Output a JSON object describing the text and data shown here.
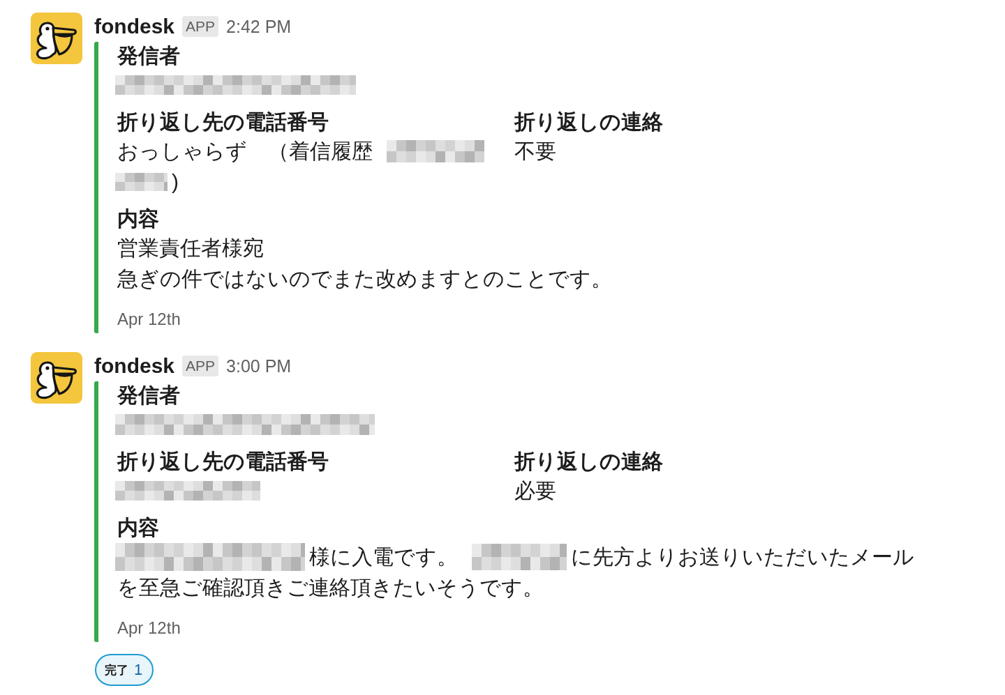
{
  "messages": [
    {
      "sender": "fondesk",
      "badge": "APP",
      "time": "2:42 PM",
      "attachment": {
        "rows": [
          [
            {
              "title": "発信者",
              "lines": [
                [
                  {
                    "kind": "redacted"
                  }
                ]
              ]
            }
          ],
          [
            {
              "title": "折り返し先の電話番号",
              "lines": [
                [
                  {
                    "kind": "text",
                    "text": "おっしゃらず　（着信履歴"
                  },
                  {
                    "kind": "redacted"
                  }
                ],
                [
                  {
                    "kind": "redacted"
                  },
                  {
                    "kind": "text",
                    "text": ")"
                  }
                ]
              ]
            },
            {
              "title": "折り返しの連絡",
              "lines": [
                [
                  {
                    "kind": "text",
                    "text": "不要"
                  }
                ]
              ]
            }
          ],
          [
            {
              "title": "内容",
              "lines": [
                [
                  {
                    "kind": "text",
                    "text": "営業責任者様宛"
                  }
                ],
                [
                  {
                    "kind": "text",
                    "text": "急ぎの件ではないのでまた改めますとのことです。"
                  }
                ]
              ]
            }
          ]
        ],
        "footer": "Apr 12th"
      }
    },
    {
      "sender": "fondesk",
      "badge": "APP",
      "time": "3:00 PM",
      "attachment": {
        "rows": [
          [
            {
              "title": "発信者",
              "lines": [
                [
                  {
                    "kind": "redacted"
                  }
                ]
              ]
            }
          ],
          [
            {
              "title": "折り返し先の電話番号",
              "lines": [
                [
                  {
                    "kind": "redacted"
                  }
                ]
              ]
            },
            {
              "title": "折り返しの連絡",
              "lines": [
                [
                  {
                    "kind": "text",
                    "text": "必要"
                  }
                ]
              ]
            }
          ],
          [
            {
              "title": "内容",
              "lines": [
                [
                  {
                    "kind": "redacted"
                  },
                  {
                    "kind": "text",
                    "text": "様に入電です。"
                  },
                  {
                    "kind": "redacted"
                  },
                  {
                    "kind": "text",
                    "text": "に先方よりお送りいただいたメール"
                  }
                ],
                [
                  {
                    "kind": "text",
                    "text": "を至急ご確認頂きご連絡頂きたいそうです。"
                  }
                ]
              ]
            }
          ]
        ],
        "footer": "Apr 12th"
      },
      "reactions": [
        {
          "emoji": "完了",
          "count": "1",
          "selected": true
        }
      ]
    }
  ]
}
